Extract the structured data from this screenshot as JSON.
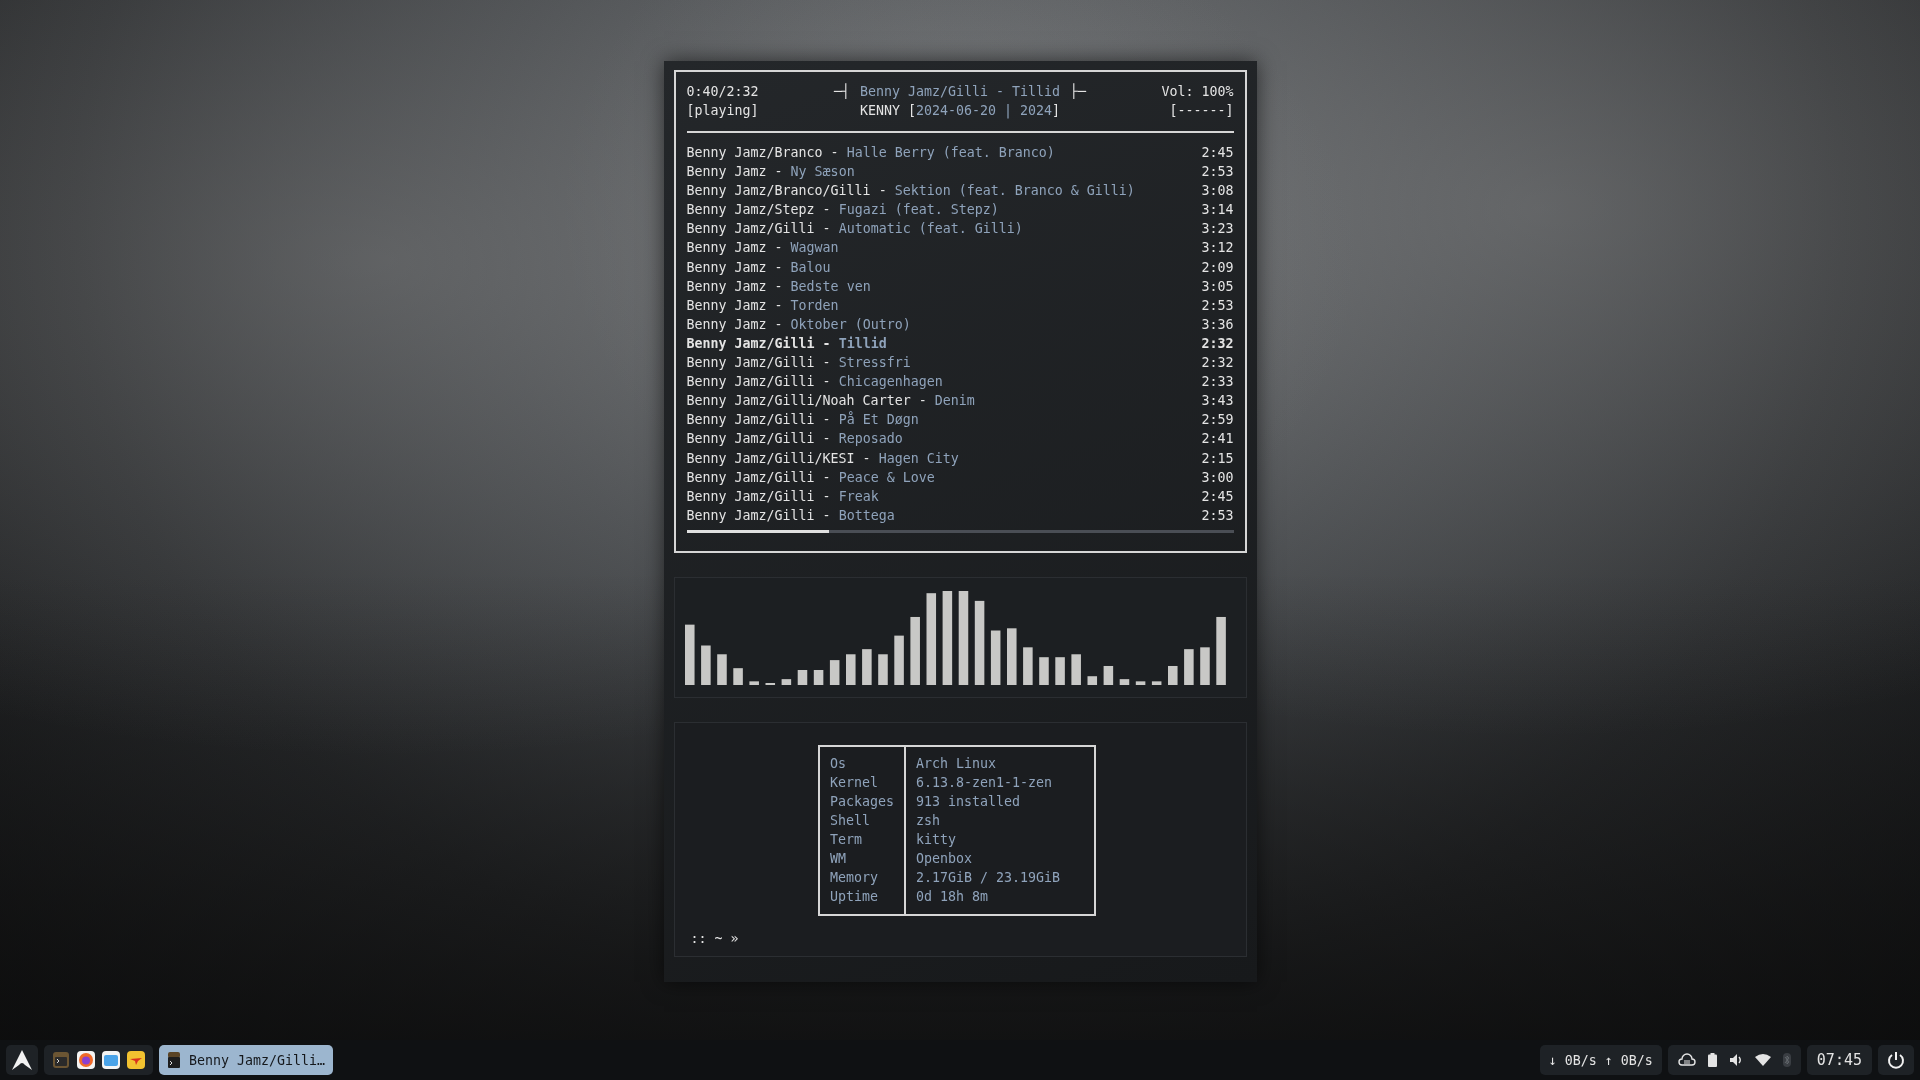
{
  "player": {
    "position": "0:40/2:32",
    "status": "[playing]",
    "title_left_mark": "─┤",
    "now_playing": "Benny Jamz/Gilli - Tillid",
    "title_right_mark": "├─",
    "album_line": [
      {
        "text": "KENNY [",
        "kind": "plain"
      },
      {
        "text": "2024-06-20 | 2024",
        "kind": "accent"
      },
      {
        "text": "]",
        "kind": "plain"
      }
    ],
    "volume": "Vol: 100%",
    "volume_bar": "[------]",
    "tracks": [
      {
        "artist": "Benny Jamz/Branco -",
        "title": "Halle Berry (feat. Branco)",
        "duration": "2:45",
        "selected": false
      },
      {
        "artist": "Benny Jamz -",
        "title": "Ny Sæson",
        "duration": "2:53",
        "selected": false
      },
      {
        "artist": "Benny Jamz/Branco/Gilli -",
        "title": "Sektion (feat. Branco & Gilli)",
        "duration": "3:08",
        "selected": false
      },
      {
        "artist": "Benny Jamz/Stepz -",
        "title": "Fugazi (feat. Stepz)",
        "duration": "3:14",
        "selected": false
      },
      {
        "artist": "Benny Jamz/Gilli -",
        "title": "Automatic (feat. Gilli)",
        "duration": "3:23",
        "selected": false
      },
      {
        "artist": "Benny Jamz -",
        "title": "Wagwan",
        "duration": "3:12",
        "selected": false
      },
      {
        "artist": "Benny Jamz -",
        "title": "Balou",
        "duration": "2:09",
        "selected": false
      },
      {
        "artist": "Benny Jamz -",
        "title": "Bedste ven",
        "duration": "3:05",
        "selected": false
      },
      {
        "artist": "Benny Jamz -",
        "title": "Torden",
        "duration": "2:53",
        "selected": false
      },
      {
        "artist": "Benny Jamz -",
        "title": "Oktober (Outro)",
        "duration": "3:36",
        "selected": false
      },
      {
        "artist": "Benny Jamz/Gilli -",
        "title": "Tillid",
        "duration": "2:32",
        "selected": true
      },
      {
        "artist": "Benny Jamz/Gilli -",
        "title": "Stressfri",
        "duration": "2:32",
        "selected": false
      },
      {
        "artist": "Benny Jamz/Gilli -",
        "title": "Chicagenhagen",
        "duration": "2:33",
        "selected": false
      },
      {
        "artist": "Benny Jamz/Gilli/Noah Carter -",
        "title": "Denim",
        "duration": "3:43",
        "selected": false
      },
      {
        "artist": "Benny Jamz/Gilli -",
        "title": "På Et Døgn",
        "duration": "2:59",
        "selected": false
      },
      {
        "artist": "Benny Jamz/Gilli -",
        "title": "Reposado",
        "duration": "2:41",
        "selected": false
      },
      {
        "artist": "Benny Jamz/Gilli/KESI -",
        "title": "Hagen City",
        "duration": "2:15",
        "selected": false
      },
      {
        "artist": "Benny Jamz/Gilli -",
        "title": "Peace & Love",
        "duration": "3:00",
        "selected": false
      },
      {
        "artist": "Benny Jamz/Gilli -",
        "title": "Freak",
        "duration": "2:45",
        "selected": false
      },
      {
        "artist": "Benny Jamz/Gilli -",
        "title": "Bottega",
        "duration": "2:53",
        "selected": false
      }
    ],
    "progress": {
      "level": 0.26
    }
  },
  "system_info": {
    "rows": [
      {
        "label": "Os",
        "value": "Arch Linux"
      },
      {
        "label": "Kernel",
        "value": "6.13.8-zen1-1-zen"
      },
      {
        "label": "Packages",
        "value": "913 installed"
      },
      {
        "label": "Shell",
        "value": "zsh"
      },
      {
        "label": "Term",
        "value": "kitty"
      },
      {
        "label": "WM",
        "value": "Openbox"
      },
      {
        "label": "Memory",
        "value": "2.17GiB / 23.19GiB"
      },
      {
        "label": "Uptime",
        "value": "0d 18h 8m"
      }
    ],
    "prompt": ":: ~ »"
  },
  "taskbar": {
    "active_task": "Benny Jamz/Gilli…",
    "network": "↓ 0B/s ↑ 0B/s",
    "clock": "07:45"
  }
}
